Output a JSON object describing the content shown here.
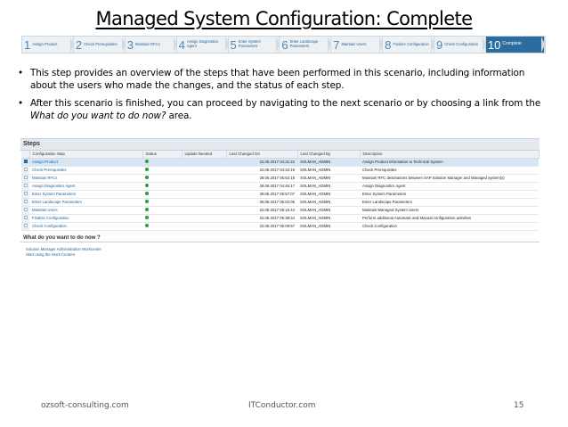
{
  "title": "Managed System Configuration: Complete",
  "wizard": [
    {
      "num": "1",
      "label": "Assign Product"
    },
    {
      "num": "2",
      "label": "Check Prerequisites"
    },
    {
      "num": "3",
      "label": "Maintain RFCs"
    },
    {
      "num": "4",
      "label": "Assign Diagnostics Agent"
    },
    {
      "num": "5",
      "label": "Enter System Parameters"
    },
    {
      "num": "6",
      "label": "Enter Landscape Parameters"
    },
    {
      "num": "7",
      "label": "Maintain Users"
    },
    {
      "num": "8",
      "label": "Finalize Configuration"
    },
    {
      "num": "9",
      "label": "Check Configuration"
    },
    {
      "num": "10",
      "label": "Complete"
    }
  ],
  "bullets": {
    "b1": "This step provides an overview of the steps that have been performed in this scenario, including information about the users who made the changes, and the status of each step.",
    "b2_pre": "After this scenario is finished, you can proceed by navigating to the next scenario or by choosing a link from the",
    "b2_em": "What do you want to do now?",
    "b2_post": " area."
  },
  "steps_panel": {
    "title": "Steps",
    "columns": [
      "Configuration Step",
      "Status",
      "Update Needed",
      "Last Changed On",
      "Last Changed By",
      "Description"
    ],
    "rows": [
      {
        "step": "Assign Product",
        "changed_on": "22.06.2017 04:31:22",
        "changed_by": "SOLMAN_ADMIN",
        "description": "Assign Product information to Technical System"
      },
      {
        "step": "Check Prerequisites",
        "changed_on": "22.06.2017 04:34:19",
        "changed_by": "SOLMAN_ADMIN",
        "description": "Check Prerequisites"
      },
      {
        "step": "Maintain RFCs",
        "changed_on": "28.06.2017 05:52:18",
        "changed_by": "SOLMAN_ADMIN",
        "description": "Maintain RFC destinations between SAP Solution Manager and Managed system(s)"
      },
      {
        "step": "Assign Diagnostics Agent",
        "changed_on": "28.06.2017 04:46:17",
        "changed_by": "SOLMAN_ADMIN",
        "description": "Assign Diagnostics Agent"
      },
      {
        "step": "Enter System Parameters",
        "changed_on": "28.06.2017 05:57:07",
        "changed_by": "SOLMAN_ADMIN",
        "description": "Enter System Parameters"
      },
      {
        "step": "Enter Landscape Parameters",
        "changed_on": "28.06.2017 06:02:06",
        "changed_by": "SOLMAN_ADMIN",
        "description": "Enter Landscape Parameters"
      },
      {
        "step": "Maintain Users",
        "changed_on": "22.06.2017 05:16:44",
        "changed_by": "SOLMAN_ADMIN",
        "description": "Maintain Managed System Users"
      },
      {
        "step": "Finalize Configuration",
        "changed_on": "22.06.2017 05:38:34",
        "changed_by": "SOLMAN_ADMIN",
        "description": "Perform additional Automatic and Manual configuration activities"
      },
      {
        "step": "Check Configuration",
        "changed_on": "22.06.2017 06:08:57",
        "changed_by": "SOLMAN_ADMIN",
        "description": "Check Configuration"
      }
    ],
    "what_next_title": "What do you want to do now ?",
    "links": [
      "Solution Manager Administration Workcenter",
      "Start using the Work Centers"
    ]
  },
  "footer": {
    "left": "ozsoft-consulting.com",
    "center": "ITConductor.com",
    "page": "15"
  },
  "colors": {
    "accent": "#2b6d9f",
    "status_ok": "#2e9e3a"
  }
}
